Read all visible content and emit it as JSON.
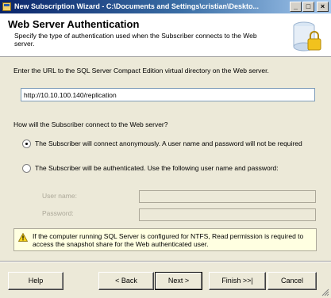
{
  "window": {
    "title": "New Subscription Wizard - C:\\Documents and Settings\\cristian\\Deskto...",
    "min_glyph": "_",
    "max_glyph": "□",
    "close_glyph": "×"
  },
  "header": {
    "title": "Web Server Authentication",
    "description": "Specify the type of authentication used when the Subscriber connects to the Web server.",
    "icon": "authentication-wizard-icon"
  },
  "url_section": {
    "prompt": "Enter the URL to the SQL Server Compact Edition virtual directory on the Web server.",
    "url_value": "http://10.10.100.140/replication"
  },
  "connect_section": {
    "question": "How will the Subscriber connect to the Web server?",
    "options": [
      {
        "label": "The Subscriber will connect anonymously. A user name and password will not be required",
        "selected": true
      },
      {
        "label": "The Subscriber will be authenticated. Use the following user name and password:",
        "selected": false
      }
    ],
    "username_label": "User name:",
    "password_label": "Password:"
  },
  "warning": {
    "icon": "warning-icon",
    "text": "If the computer running SQL Server is configured for NTFS, Read permission is required to access the snapshot share for the Web authenticated user."
  },
  "buttons": {
    "help": "Help",
    "back": "< Back",
    "next": "Next >",
    "finish": "Finish >>|",
    "cancel": "Cancel"
  },
  "colors": {
    "titlebar_start": "#0a246a",
    "titlebar_end": "#a6caf0",
    "dialog_bg": "#ece9d8",
    "warning_bg": "#ffffe1"
  }
}
